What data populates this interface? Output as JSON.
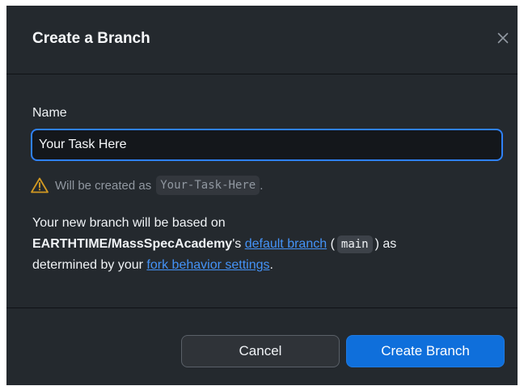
{
  "dialog": {
    "title": "Create a Branch",
    "close_icon": "close-icon"
  },
  "form": {
    "name_label": "Name",
    "name_value": "Your Task Here",
    "warning_icon": "warning-icon",
    "warning_prefix": "Will be created as",
    "warning_branch": "Your-Task-Here",
    "warning_suffix": "."
  },
  "description": {
    "line1": "Your new branch will be based on",
    "repo": "EARTHTIME/MassSpecAcademy",
    "possessive": "'s",
    "default_branch_link": "default branch",
    "paren_open": "(",
    "branch_name": "main",
    "paren_close": ")",
    "as": "as",
    "determined_by": "determined by your",
    "fork_settings_link": "fork behavior settings",
    "period": "."
  },
  "footer": {
    "cancel_label": "Cancel",
    "create_label": "Create Branch"
  },
  "colors": {
    "background": "#24292e",
    "accent": "#2f81f7",
    "link": "#4493f8",
    "warning": "#d29922",
    "primary_button": "#0f6fdb"
  }
}
